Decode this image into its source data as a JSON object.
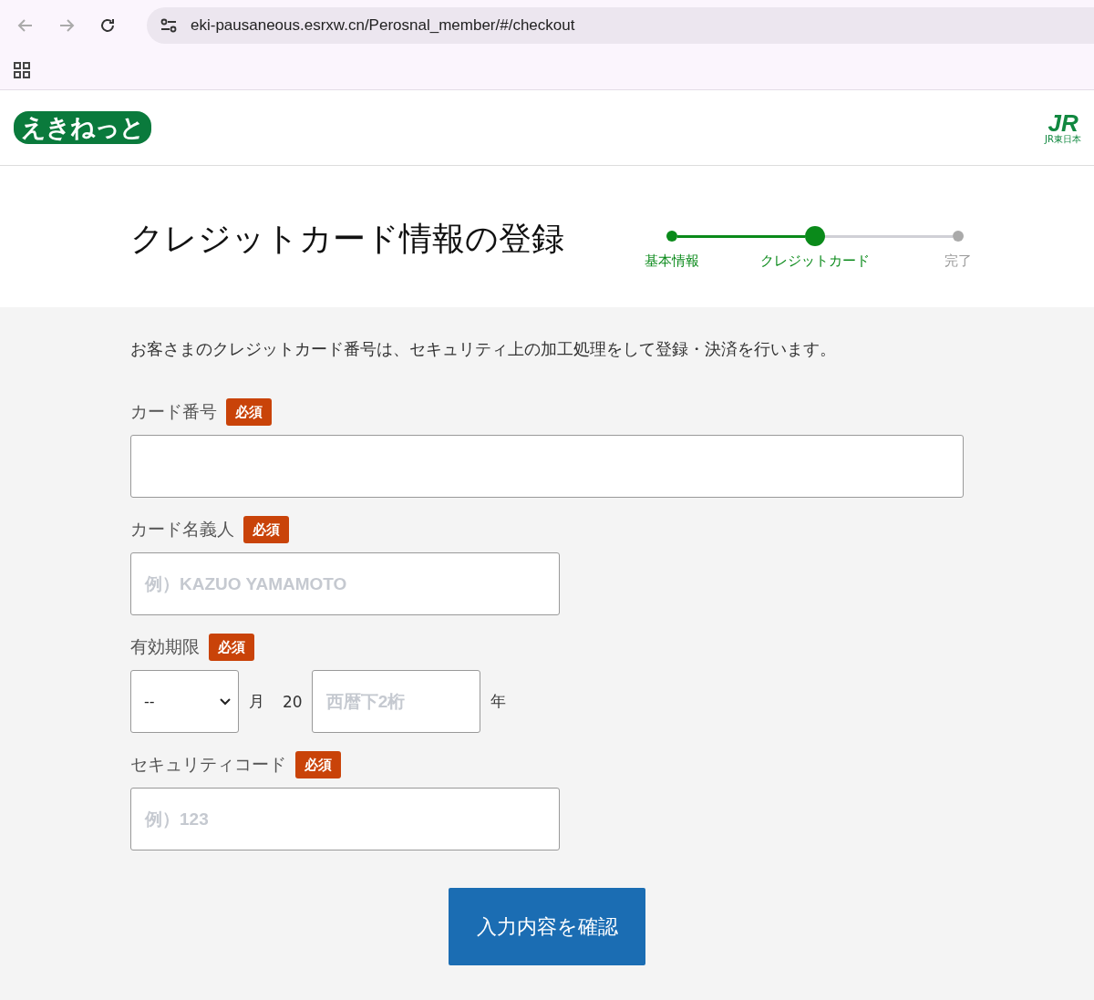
{
  "browser": {
    "url": "eki-pausaneous.esrxw.cn/Perosnal_member/#/checkout"
  },
  "header": {
    "logo": "えきねっと",
    "brand_mark": "JR",
    "brand_caption": "JR東日本"
  },
  "title": "クレジットカード情報の登録",
  "steps": [
    {
      "label": "基本情報",
      "completed": true,
      "selected": false
    },
    {
      "label": "クレジットカード",
      "completed": false,
      "selected": true
    },
    {
      "label": "完了",
      "completed": false,
      "selected": false
    }
  ],
  "intro": "お客さまのクレジットカード番号は、セキュリティ上の加工処理をして登録・決済を行います。",
  "fields": [
    {
      "kind": "text",
      "label": "カード番号",
      "badge": "必須",
      "wide": true
    },
    {
      "kind": "text",
      "label": "カード名義人",
      "badge": "必須",
      "wide": false,
      "placeholder": "例）KAZUO YAMAMOTO"
    },
    {
      "kind": "expiry",
      "label": "有効期限",
      "badge": "必須",
      "month_value": "--",
      "month_unit": "月",
      "year_prefix": "20",
      "year_placeholder": "西暦下2桁",
      "year_unit": "年"
    },
    {
      "kind": "text",
      "label": "セキュリティコード",
      "badge": "必須",
      "wide": false,
      "placeholder": "例）123"
    }
  ],
  "submit": "入力内容を確認"
}
